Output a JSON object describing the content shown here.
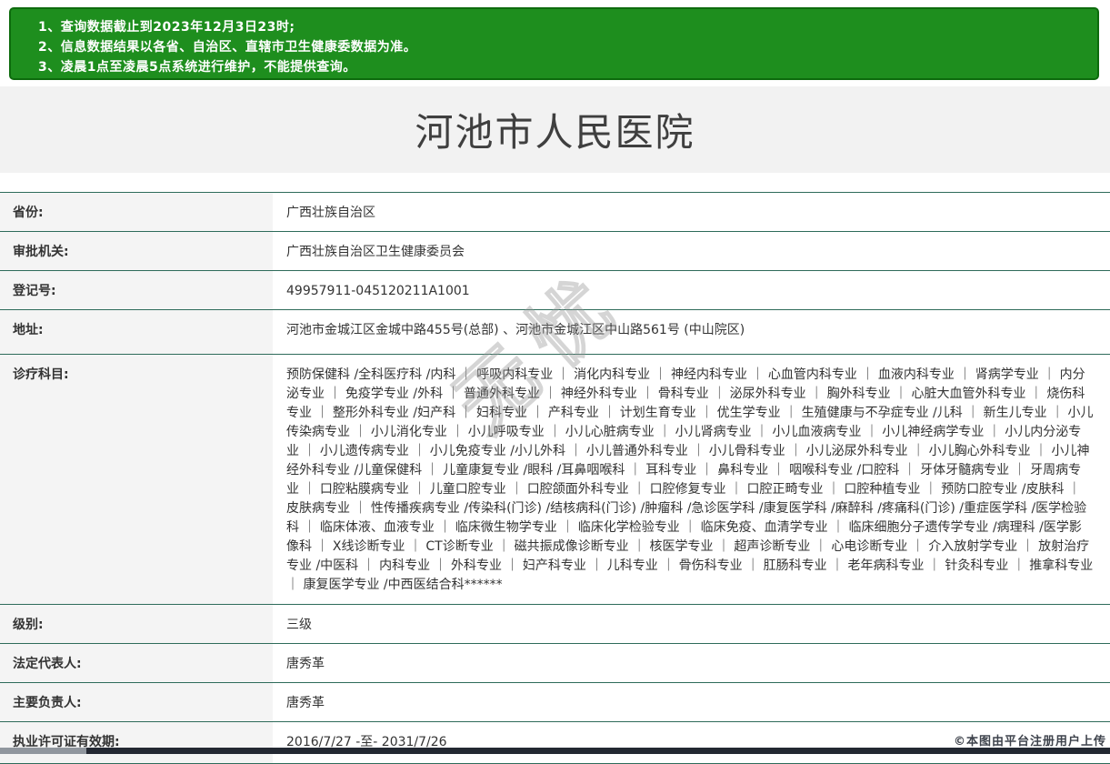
{
  "notice": {
    "lines": [
      "1、查询数据截止到2023年12月3日23时;",
      "2、信息数据结果以各省、自治区、直辖市卫生健康委数据为准。",
      "3、凌晨1点至凌晨5点系统进行维护，不能提供查询。"
    ]
  },
  "title": "河池市人民医院",
  "info_table": {
    "rows": [
      {
        "label": "省份:",
        "value": "广西壮族自治区"
      },
      {
        "label": "审批机关:",
        "value": "广西壮族自治区卫生健康委员会"
      },
      {
        "label": "登记号:",
        "value": "49957911-045120211A1001"
      },
      {
        "label": "地址:",
        "value": "河池市金城江区金城中路455号(总部) 、河池市金城江区中山路561号 (中山院区)"
      },
      {
        "label": "诊疗科目:",
        "value": "预防保健科 /全科医疗科 /内科 ｜ 呼吸内科专业 ｜ 消化内科专业 ｜ 神经内科专业 ｜ 心血管内科专业 ｜ 血液内科专业 ｜ 肾病学专业 ｜ 内分泌专业 ｜ 免疫学专业 /外科 ｜ 普通外科专业 ｜ 神经外科专业 ｜ 骨科专业 ｜ 泌尿外科专业 ｜ 胸外科专业 ｜ 心脏大血管外科专业 ｜ 烧伤科专业 ｜ 整形外科专业 /妇产科 ｜ 妇科专业 ｜ 产科专业 ｜ 计划生育专业 ｜ 优生学专业 ｜ 生殖健康与不孕症专业 /儿科 ｜ 新生儿专业 ｜ 小儿传染病专业 ｜ 小儿消化专业 ｜ 小儿呼吸专业 ｜ 小儿心脏病专业 ｜ 小儿肾病专业 ｜ 小儿血液病专业 ｜ 小儿神经病学专业 ｜ 小儿内分泌专业 ｜ 小儿遗传病专业 ｜ 小儿免疫专业 /小儿外科 ｜ 小儿普通外科专业 ｜ 小儿骨科专业 ｜ 小儿泌尿外科专业 ｜ 小儿胸心外科专业 ｜ 小儿神经外科专业 /儿童保健科 ｜ 儿童康复专业 /眼科 /耳鼻咽喉科 ｜ 耳科专业 ｜ 鼻科专业 ｜ 咽喉科专业 /口腔科 ｜ 牙体牙髓病专业 ｜ 牙周病专业 ｜ 口腔粘膜病专业 ｜ 儿童口腔专业 ｜ 口腔颌面外科专业 ｜ 口腔修复专业 ｜ 口腔正畸专业 ｜ 口腔种植专业 ｜ 预防口腔专业 /皮肤科 ｜ 皮肤病专业 ｜ 性传播疾病专业 /传染科(门诊) /结核病科(门诊) /肿瘤科 /急诊医学科 /康复医学科 /麻醉科 /疼痛科(门诊) /重症医学科 /医学检验科 ｜ 临床体液、血液专业 ｜ 临床微生物学专业 ｜ 临床化学检验专业 ｜ 临床免疫、血清学专业 ｜ 临床细胞分子遗传学专业 /病理科 /医学影像科 ｜ X线诊断专业 ｜ CT诊断专业 ｜ 磁共振成像诊断专业 ｜ 核医学专业 ｜ 超声诊断专业 ｜ 心电诊断专业 ｜ 介入放射学专业 ｜ 放射治疗专业 /中医科 ｜ 内科专业 ｜ 外科专业 ｜ 妇产科专业 ｜ 儿科专业 ｜ 骨伤科专业 ｜ 肛肠科专业 ｜ 老年病科专业 ｜ 针灸科专业 ｜ 推拿科专业 ｜ 康复医学专业 /中西医结合科******"
      },
      {
        "label": "级别:",
        "value": "三级"
      },
      {
        "label": "法定代表人:",
        "value": "唐秀革"
      },
      {
        "label": "主要负责人:",
        "value": "唐秀革"
      },
      {
        "label": "执业许可证有效期:",
        "value": "2016/7/27 -至- 2031/7/26"
      }
    ]
  },
  "watermarks": {
    "diagonal_text": "无忧",
    "credit": "©本图由平台注册用户上传"
  },
  "colors": {
    "notice_bg": "#1e8e1e",
    "notice_border": "#0d6b0d",
    "row_separator": "#2e6b5a",
    "label_bg": "#f4f4f4",
    "title_band_bg": "#f2f2f2",
    "footer_bar": "#232832"
  }
}
